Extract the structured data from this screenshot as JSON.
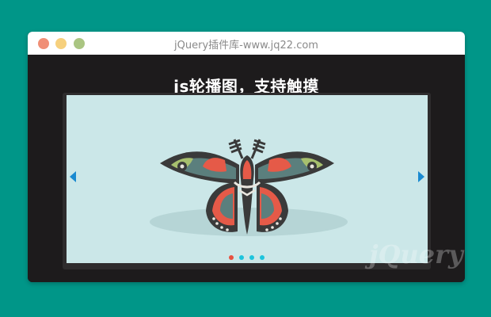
{
  "window": {
    "title": "jQuery插件库-www.jq22.com"
  },
  "demo": {
    "heading": "js轮播图，支持触摸"
  },
  "carousel": {
    "slide_image": "moth-illustration",
    "prev_icon": "caret-left-icon",
    "next_icon": "caret-right-icon",
    "active_index": 0,
    "dots": [
      {
        "color": "#e8513f",
        "active": true
      },
      {
        "color": "#1ec4dc",
        "active": false
      },
      {
        "color": "#1ec4dc",
        "active": false
      },
      {
        "color": "#1ec4dc",
        "active": false
      }
    ],
    "accent_color": "#1a8ad0"
  },
  "colors": {
    "page_bg": "#009688",
    "window_bg": "#1d1b1c",
    "slide_bg": "#cbe7e8"
  },
  "watermark": {
    "text": "jQuery"
  }
}
